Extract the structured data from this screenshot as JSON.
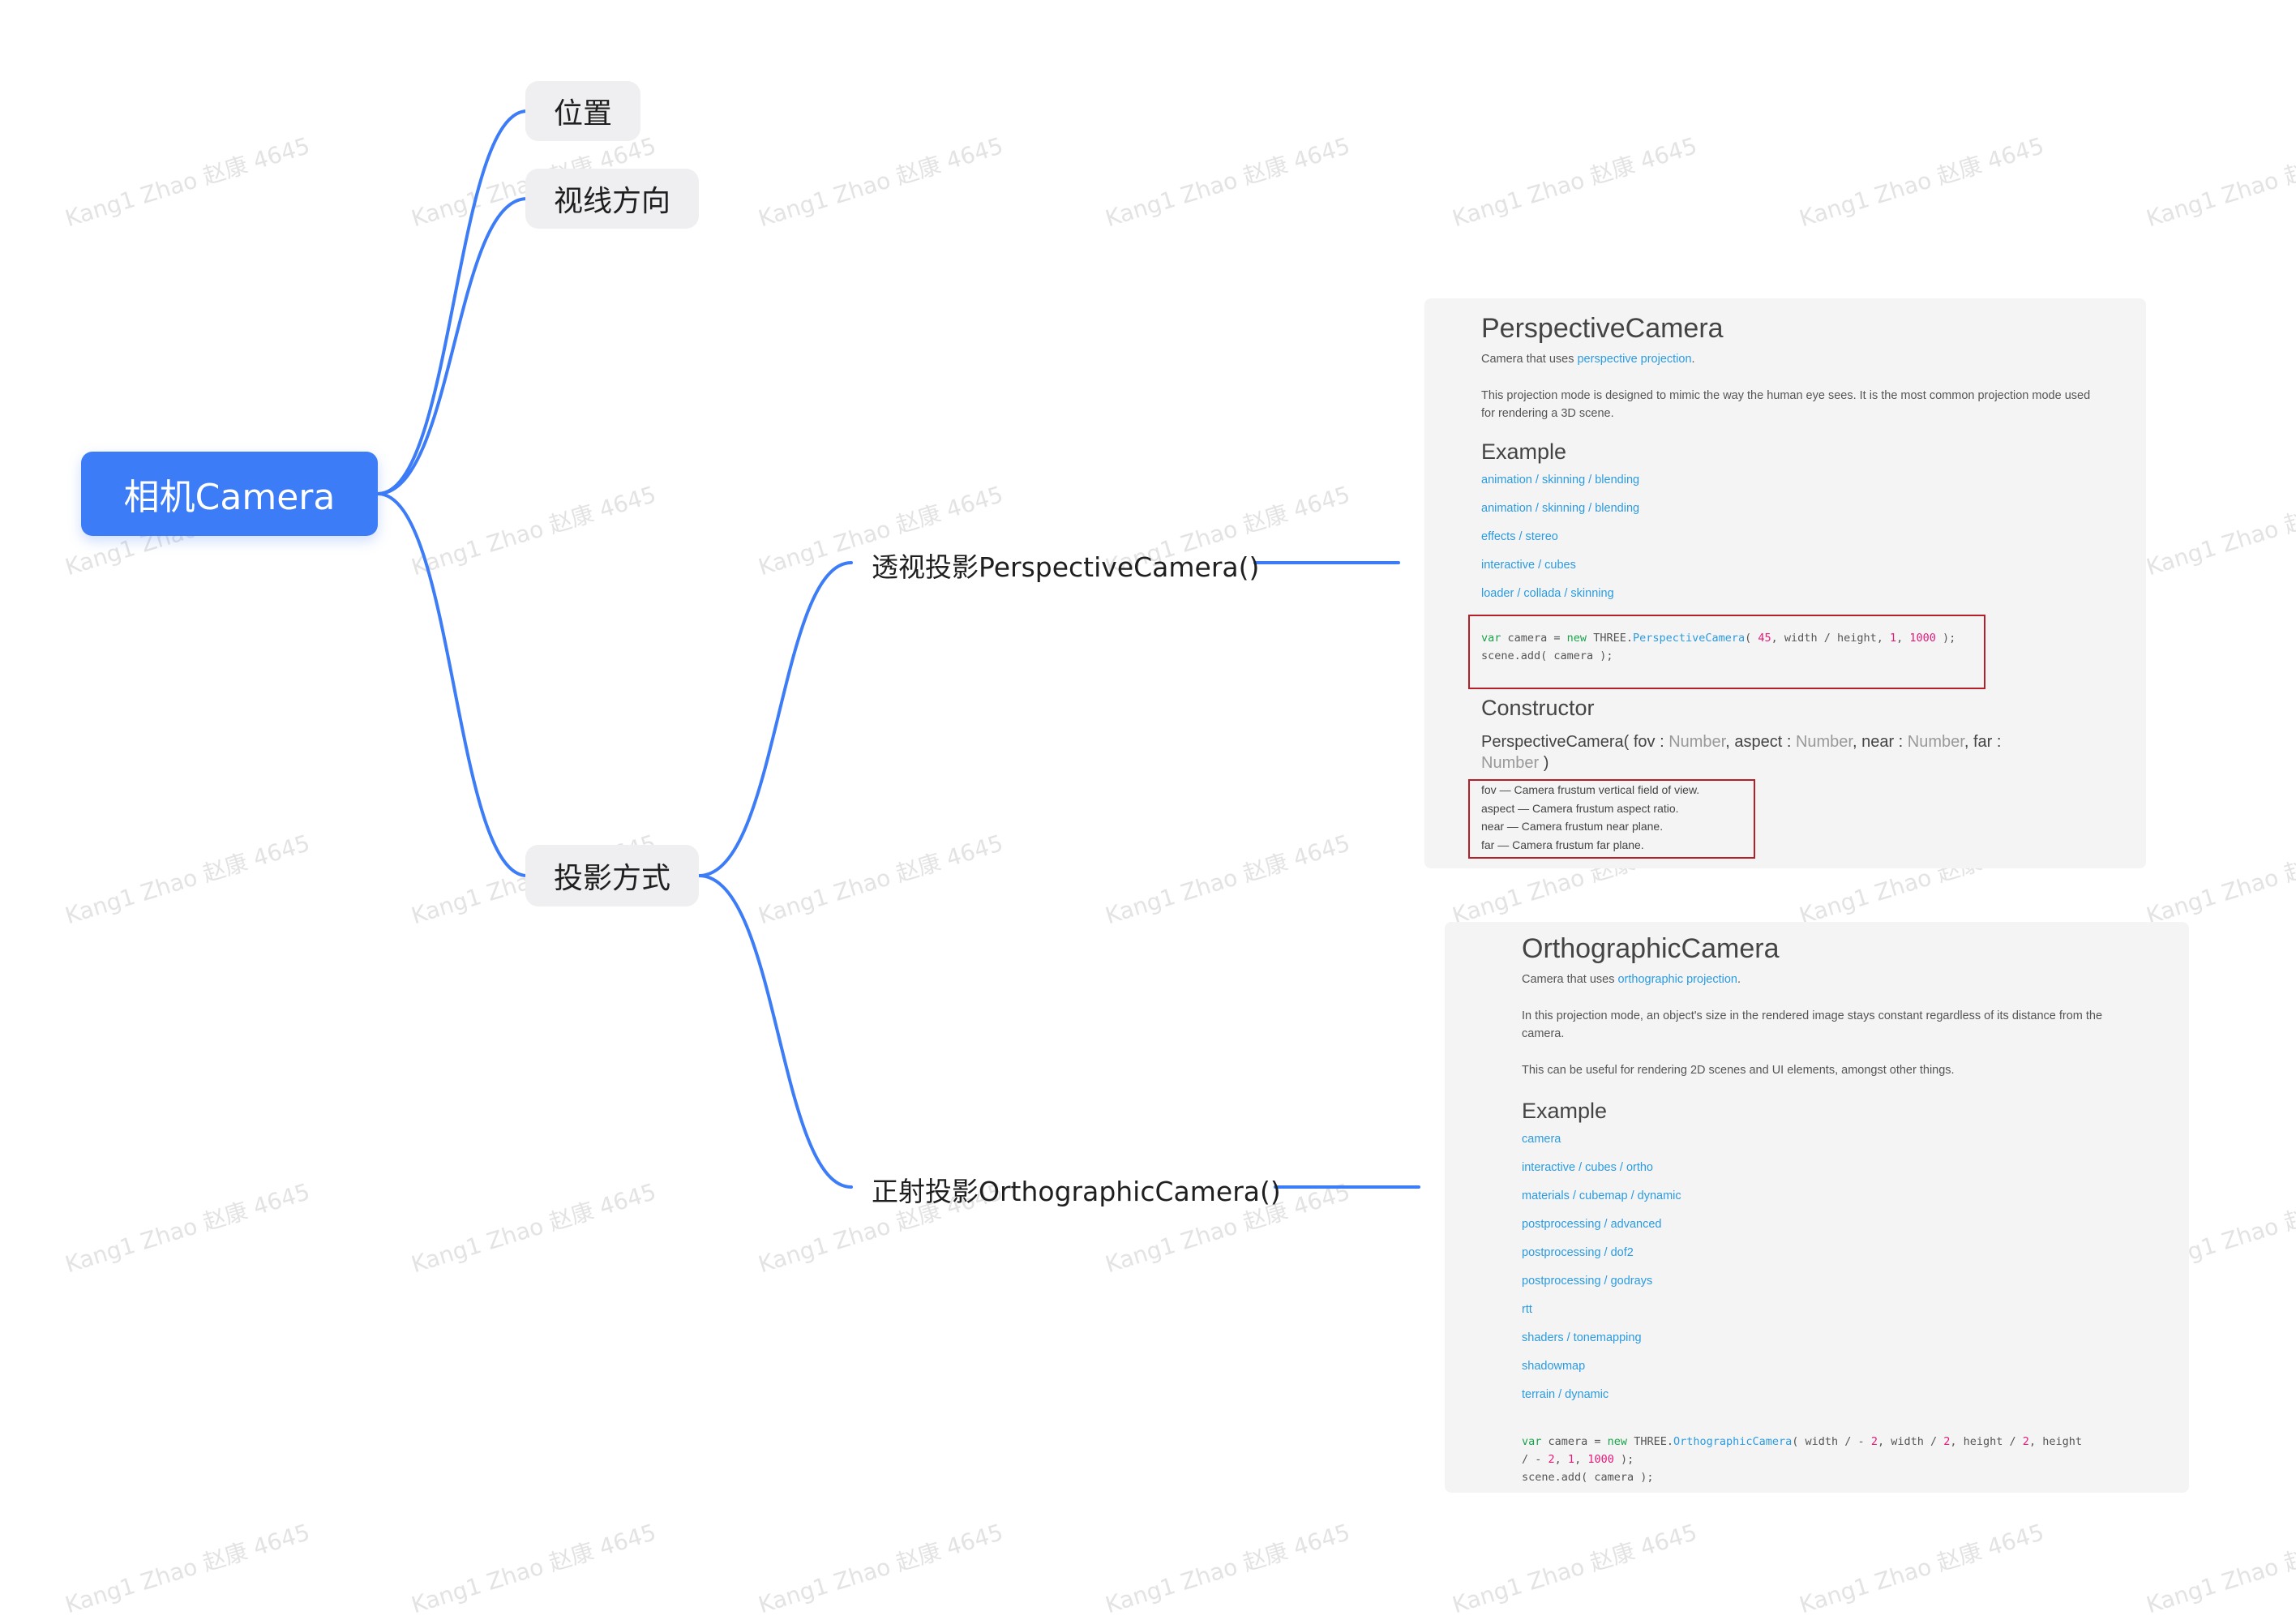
{
  "watermark": "Kang1 Zhao 赵康 4645",
  "colors": {
    "accent": "#3d7cf7",
    "link": "#2b9be0",
    "highlight_box": "#b41f2a",
    "keyword": "#1aa34a",
    "number": "#e5197a"
  },
  "root": {
    "label": "相机Camera"
  },
  "topics": {
    "position": "位置",
    "direction": "视线方向",
    "projection": "投影方式"
  },
  "subtopics": {
    "perspective": "透视投影PerspectiveCamera()",
    "orthographic": "正射投影OrthographicCamera()"
  },
  "perspective_doc": {
    "title": "PerspectiveCamera",
    "intro_prefix": "Camera that uses ",
    "intro_link": "perspective projection",
    "intro_suffix": ".",
    "description": "This projection mode is designed to mimic the way the human eye sees. It is the most common projection mode used for rendering a 3D scene.",
    "example_heading": "Example",
    "examples": [
      "animation / skinning / blending",
      "animation / skinning / blending",
      "effects / stereo",
      "interactive / cubes",
      "loader / collada / skinning"
    ],
    "code": {
      "kw_var": "var",
      "name": " camera = ",
      "kw_new": "new",
      "three": " THREE.",
      "cls": "PerspectiveCamera",
      "open": "( ",
      "n1": "45",
      "mid": ", width / height, ",
      "n2": "1",
      "sep": ", ",
      "n3": "1000",
      "close": " );",
      "line2": "scene.add( camera );"
    },
    "constructor_heading": "Constructor",
    "ctor": {
      "name": "PerspectiveCamera( fov : ",
      "t1": "Number",
      "p2": ", aspect : ",
      "t2": "Number",
      "p3": ", near : ",
      "t3": "Number",
      "p4": ", far : ",
      "t4": "Number",
      "end": " )"
    },
    "params": [
      "fov — Camera frustum vertical field of view.",
      "aspect — Camera frustum aspect ratio.",
      "near — Camera frustum near plane.",
      "far — Camera frustum far plane."
    ]
  },
  "ortho_doc": {
    "title": "OrthographicCamera",
    "intro_prefix": "Camera that uses ",
    "intro_link": "orthographic projection",
    "intro_suffix": ".",
    "description1": "In this projection mode, an object's size in the rendered image stays constant regardless of its distance from the camera.",
    "description2": "This can be useful for rendering 2D scenes and UI elements, amongst other things.",
    "example_heading": "Example",
    "examples": [
      "camera",
      "interactive / cubes / ortho",
      "materials / cubemap / dynamic",
      "postprocessing / advanced",
      "postprocessing / dof2",
      "postprocessing / godrays",
      "rtt",
      "shaders / tonemapping",
      "shadowmap",
      "terrain / dynamic"
    ],
    "code": {
      "kw_var": "var",
      "name": " camera = ",
      "kw_new": "new",
      "three": " THREE.",
      "cls": "OrthographicCamera",
      "a1": "( width / - ",
      "n1": "2",
      "a2": ", width / ",
      "n2": "2",
      "a3": ", height / ",
      "n3": "2",
      "a4": ", height",
      "b1": "/ - ",
      "n4": "2",
      "b2": ", ",
      "n5": "1",
      "b3": ", ",
      "n6": "1000",
      "b4": " );",
      "line3": "scene.add( camera );"
    }
  }
}
